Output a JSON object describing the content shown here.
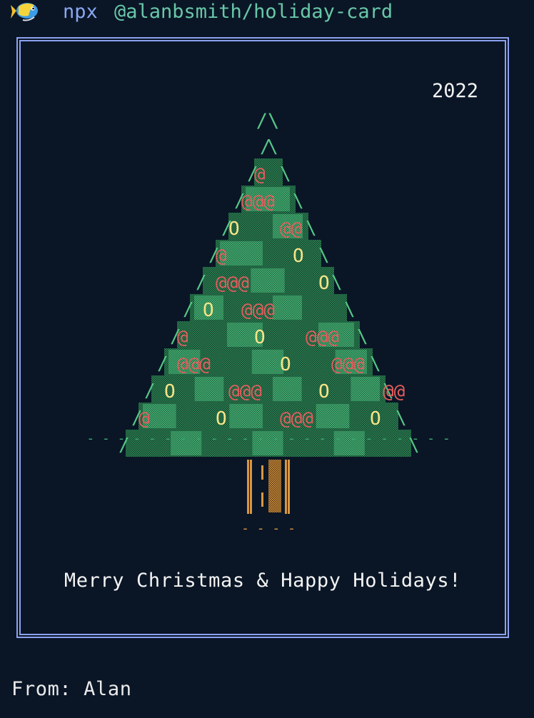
{
  "prompt": {
    "icon": "tropical-fish-icon",
    "command": "npx",
    "package": "@alanbsmith/holiday-card"
  },
  "card": {
    "year": "2022",
    "greeting": "Merry Christmas & Happy Holidays!",
    "from": "From: Alan"
  },
  "colors": {
    "background": "#0a1626",
    "border": "#8da1ef",
    "tree_dark": "#25714b",
    "tree_light": "#3dab72",
    "tree_edge": "#55c786",
    "ornament_red": "#e25d5d",
    "ornament_yellow": "#f6e487",
    "trunk": "#d99742",
    "text": "#f3f3f3"
  },
  "tree": {
    "top": "/\\",
    "ground": "- - - - - - - - - - - - - - - - - - - - - - - -",
    "base": "- - - -",
    "ornaments": [
      {
        "row": 2,
        "col": 1,
        "text": "@"
      },
      {
        "row": 3,
        "col": 1,
        "text": "@@@"
      },
      {
        "row": 4,
        "col": 1,
        "text": "O"
      },
      {
        "row": 4,
        "col": 5,
        "text": "@@"
      },
      {
        "row": 5,
        "col": 1,
        "text": "@"
      },
      {
        "row": 5,
        "col": 7,
        "text": "O"
      },
      {
        "row": 6,
        "col": 2,
        "text": "@@@"
      },
      {
        "row": 6,
        "col": 10,
        "text": "O"
      },
      {
        "row": 7,
        "col": 2,
        "text": "O"
      },
      {
        "row": 7,
        "col": 5,
        "text": "@@@"
      },
      {
        "row": 8,
        "col": 1,
        "text": "@"
      },
      {
        "row": 8,
        "col": 7,
        "text": "O"
      },
      {
        "row": 8,
        "col": 11,
        "text": "@@@"
      },
      {
        "row": 9,
        "col": 2,
        "text": "@@@"
      },
      {
        "row": 9,
        "col": 10,
        "text": "O"
      },
      {
        "row": 9,
        "col": 14,
        "text": "@@@"
      },
      {
        "row": 10,
        "col": 2,
        "text": "O"
      },
      {
        "row": 10,
        "col": 7,
        "text": "@@@"
      },
      {
        "row": 10,
        "col": 14,
        "text": "O"
      },
      {
        "row": 10,
        "col": 19,
        "text": "@@"
      },
      {
        "row": 11,
        "col": 1,
        "text": "@"
      },
      {
        "row": 11,
        "col": 7,
        "text": "O"
      },
      {
        "row": 11,
        "col": 12,
        "text": "@@@"
      },
      {
        "row": 11,
        "col": 19,
        "text": "O"
      }
    ]
  }
}
